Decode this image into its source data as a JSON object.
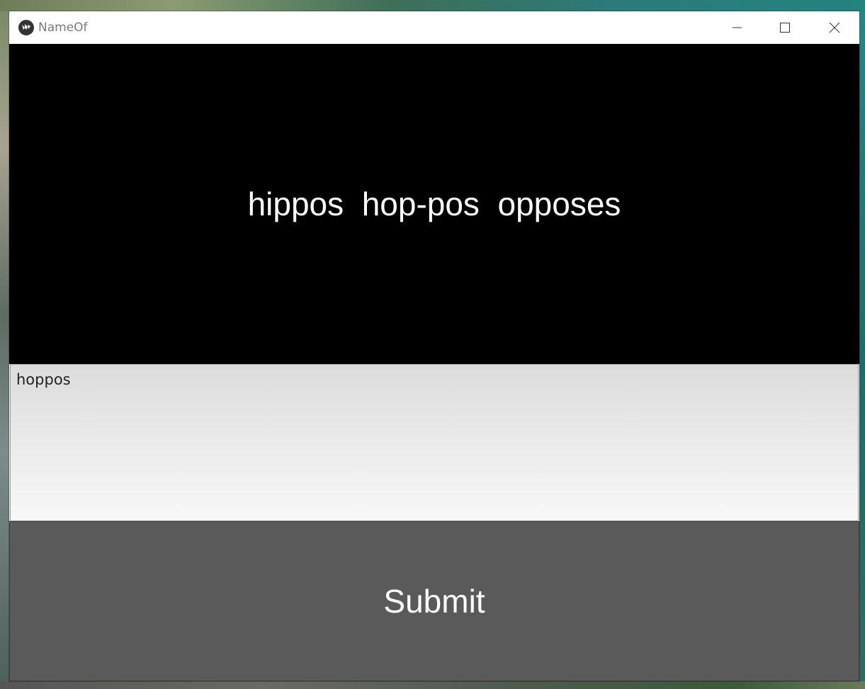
{
  "window": {
    "title": "NameOf",
    "app_icon": "kivy-logo-icon",
    "controls": [
      "minimize-icon",
      "maximize-icon",
      "close-icon"
    ]
  },
  "display": {
    "text": "hippos  hop-pos  opposes"
  },
  "input": {
    "value": "hoppos"
  },
  "submit": {
    "label": "Submit"
  },
  "colors": {
    "display_bg": "#000000",
    "display_fg": "#ffffff",
    "button_bg": "#5a5a5a",
    "button_fg": "#ffffff"
  }
}
